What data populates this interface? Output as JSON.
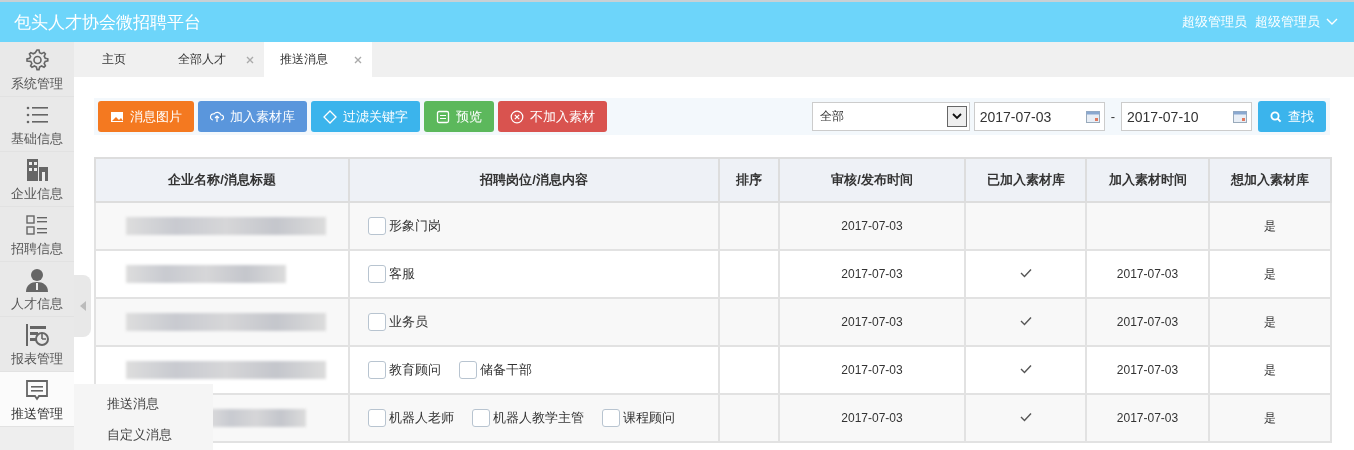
{
  "header": {
    "title": "包头人才协会微招聘平台",
    "user_role": "超级管理员",
    "user_name": "超级管理员"
  },
  "sidebar": {
    "items": [
      {
        "label": "系统管理",
        "expanded": false
      },
      {
        "label": "基础信息",
        "expanded": false
      },
      {
        "label": "企业信息",
        "expanded": false
      },
      {
        "label": "招聘信息",
        "expanded": false
      },
      {
        "label": "人才信息",
        "expanded": false
      },
      {
        "label": "报表管理",
        "expanded": false
      },
      {
        "label": "推送管理",
        "expanded": true,
        "children": [
          {
            "label": "推送消息"
          },
          {
            "label": "自定义消息"
          }
        ]
      }
    ]
  },
  "tabs": [
    {
      "label": "主页",
      "closable": false,
      "selected": false
    },
    {
      "label": "全部人才",
      "closable": true,
      "selected": false
    },
    {
      "label": "推送消息",
      "closable": true,
      "selected": true
    }
  ],
  "toolbar": {
    "buttons": [
      {
        "label": "消息图片",
        "color": "#f47920"
      },
      {
        "label": "加入素材库",
        "color": "#5a96dc"
      },
      {
        "label": "过滤关键字",
        "color": "#3bb4ec"
      },
      {
        "label": "预览",
        "color": "#5cb85c"
      },
      {
        "label": "不加入素材",
        "color": "#d9534f"
      }
    ],
    "filter": {
      "value": "全部",
      "date_from": "2017-07-03",
      "date_separator": "-",
      "date_to": "2017-07-10",
      "search_label": "查找"
    }
  },
  "table": {
    "columns": [
      "企业名称/消息标题",
      "招聘岗位/消息内容",
      "排序",
      "审核/发布时间",
      "已加入素材库",
      "加入素材时间",
      "想加入素材库"
    ],
    "rows": [
      {
        "positions": [
          {
            "label": "形象门岗",
            "checked": false
          }
        ],
        "publish_time": "2017-07-03",
        "in_library": false,
        "wants": "是"
      },
      {
        "positions": [
          {
            "label": "客服",
            "checked": false
          }
        ],
        "publish_time": "2017-07-03",
        "in_library": true,
        "added_time": "2017-07-03",
        "wants": "是"
      },
      {
        "positions": [
          {
            "label": "业务员",
            "checked": false
          }
        ],
        "publish_time": "2017-07-03",
        "in_library": true,
        "added_time": "2017-07-03",
        "wants": "是"
      },
      {
        "positions": [
          {
            "label": "教育顾问",
            "checked": false
          },
          {
            "label": "储备干部",
            "checked": false
          }
        ],
        "publish_time": "2017-07-03",
        "in_library": true,
        "added_time": "2017-07-03",
        "wants": "是"
      },
      {
        "positions": [
          {
            "label": "机器人老师",
            "checked": false
          },
          {
            "label": "机器人教学主管",
            "checked": false
          },
          {
            "label": "课程顾问",
            "checked": false
          }
        ],
        "publish_time": "2017-07-03",
        "in_library": true,
        "added_time": "2017-07-03",
        "wants": "是"
      }
    ]
  }
}
